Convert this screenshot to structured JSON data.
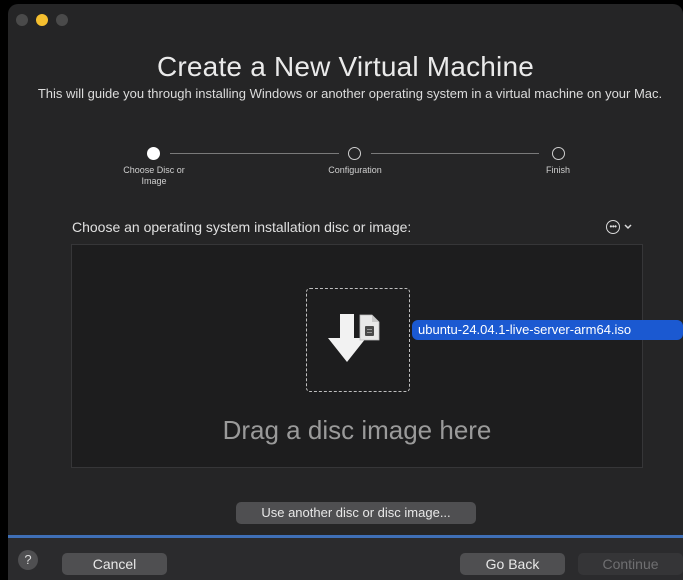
{
  "window": {
    "title": "Create a New Virtual Machine",
    "subtitle": "This will guide you through installing Windows or another operating system in a virtual machine on your Mac."
  },
  "steps": [
    {
      "label": "Choose Disc or Image",
      "active": true
    },
    {
      "label": "Configuration",
      "active": false
    },
    {
      "label": "Finish",
      "active": false
    }
  ],
  "main": {
    "choose_label": "Choose an operating system installation disc or image:",
    "drop_text": "Drag a disc image here",
    "iso_filename": "ubuntu-24.04.1-live-server-arm64.iso",
    "another_button": "Use another disc or disc image..."
  },
  "footer": {
    "help": "?",
    "cancel": "Cancel",
    "go_back": "Go Back",
    "continue": "Continue"
  },
  "colors": {
    "accent": "#1b59d1",
    "minimize": "#f5bf2f",
    "background": "#252526"
  },
  "icons": [
    "ellipsis-circle-icon",
    "chevron-down-icon",
    "download-arrow-icon",
    "disc-image-file-icon"
  ]
}
